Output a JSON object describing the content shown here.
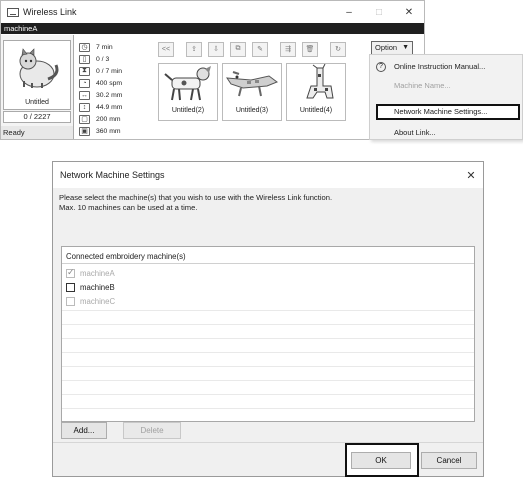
{
  "app": {
    "title": "Wireless Link",
    "window_controls": {
      "minimize": "–",
      "maximize": "□",
      "close": "✕"
    },
    "machine_tab": "machineA",
    "current": {
      "label": "Untitled",
      "counter": "0 / 2227",
      "status": "Ready"
    },
    "stats": [
      {
        "icon": "clock-icon",
        "glyph": "◷",
        "value": "7 min"
      },
      {
        "icon": "thread-spool-icon",
        "glyph": "▯",
        "value": "0 / 3"
      },
      {
        "icon": "hourglass-icon",
        "glyph": "⧗",
        "value": "0 / 7 min"
      },
      {
        "icon": "speed-icon",
        "glyph": "◔",
        "value": "400 spm"
      },
      {
        "icon": "width-icon",
        "glyph": "↔",
        "value": "30.2 mm"
      },
      {
        "icon": "height-icon",
        "glyph": "↕",
        "value": "44.9 mm"
      },
      {
        "icon": "hoop-icon",
        "glyph": "▢",
        "value": "200 mm"
      },
      {
        "icon": "hoop-large-icon",
        "glyph": "▣",
        "value": "360 mm"
      }
    ],
    "toolbar": {
      "collapse": "<<",
      "option_label": "Option",
      "option_arrow": "▼"
    },
    "designs": [
      {
        "label": "Untitled(2)"
      },
      {
        "label": "Untitled(3)"
      },
      {
        "label": "Untitled(4)"
      }
    ],
    "menu": {
      "items": [
        {
          "label": "Online Instruction Manual...",
          "state": "enabled"
        },
        {
          "label": "Machine Name...",
          "state": "disabled"
        },
        {
          "label": "Network Machine Settings...",
          "state": "highlighted"
        },
        {
          "label": "About Link...",
          "state": "enabled"
        }
      ]
    }
  },
  "dialog": {
    "title": "Network Machine Settings",
    "close_glyph": "✕",
    "message_line1": "Please select the machine(s) that you wish to use with the Wireless Link function.",
    "message_line2": "Max. 10 machines can be used at a time.",
    "list_header": "Connected embroidery machine(s)",
    "machines": [
      {
        "name": "machineA",
        "checked": true,
        "enabled": false
      },
      {
        "name": "machineB",
        "checked": false,
        "enabled": true
      },
      {
        "name": "machineC",
        "checked": false,
        "enabled": false
      }
    ],
    "buttons": {
      "add": "Add...",
      "delete": "Delete",
      "ok": "OK",
      "cancel": "Cancel"
    }
  }
}
